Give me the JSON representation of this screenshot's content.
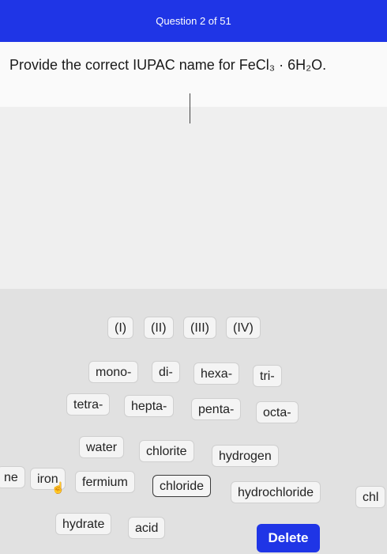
{
  "header": {
    "title": "Question 2 of 51"
  },
  "question": {
    "text": "Provide the correct IUPAC name for FeCl₃ · 6H₂O."
  },
  "bank": {
    "roman": [
      "(I)",
      "(II)",
      "(III)",
      "(IV)"
    ],
    "prefixes_row1": [
      "mono-",
      "di-",
      "hexa-",
      "tri-"
    ],
    "prefixes_row2": [
      "tetra-",
      "hepta-",
      "penta-",
      "octa-"
    ],
    "words_row1": [
      "water",
      "chlorite",
      "hydrogen"
    ],
    "words_row2": [
      "ne",
      "iron",
      "fermium",
      "chloride",
      "hydrochloride",
      "chl"
    ],
    "words_row3": [
      "hydrate",
      "acid"
    ]
  },
  "actions": {
    "delete_label": "Delete"
  },
  "colors": {
    "accent": "#1f35e6",
    "background": "#e3e3e3"
  }
}
